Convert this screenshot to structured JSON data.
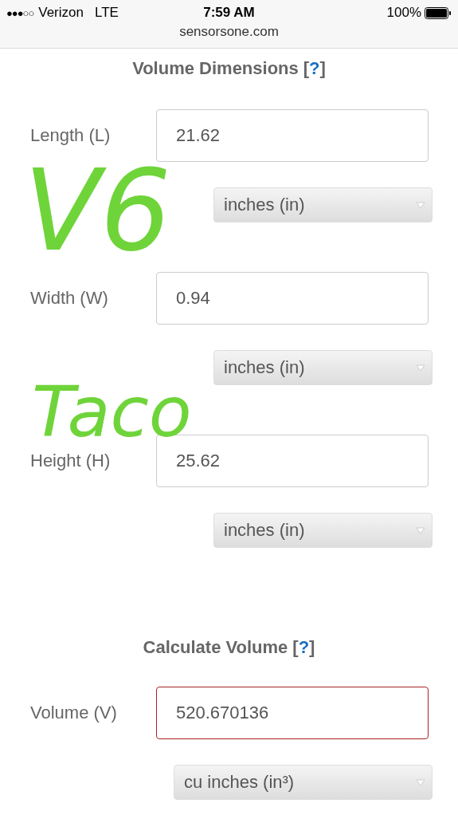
{
  "status_bar": {
    "signal": "●●●○○",
    "carrier": "Verizon",
    "network": "LTE",
    "time": "7:59 AM",
    "battery": "100%"
  },
  "address_bar": {
    "url": "sensorsone.com"
  },
  "sections": [
    {
      "title": "Volume Dimensions",
      "bracket_open": "[",
      "help": "?",
      "bracket_close": "]",
      "fields": [
        {
          "kind": "input",
          "label": "Length (L)",
          "value": "21.62",
          "unit": "inches (in)"
        },
        {
          "kind": "input",
          "label": "Width (W)",
          "value": "0.94",
          "unit": "inches (in)"
        },
        {
          "kind": "input",
          "label": "Height (H)",
          "value": "25.62",
          "unit": "inches (in)"
        }
      ]
    },
    {
      "title": "Calculate Volume",
      "bracket_open": "[",
      "help": "?",
      "bracket_close": "]",
      "fields": [
        {
          "kind": "result",
          "label": "Volume (V)",
          "value": "520.670136",
          "unit": "cu inches (in³)"
        }
      ]
    }
  ],
  "annotations": [
    {
      "text": "V6"
    },
    {
      "text": "Taco"
    }
  ]
}
